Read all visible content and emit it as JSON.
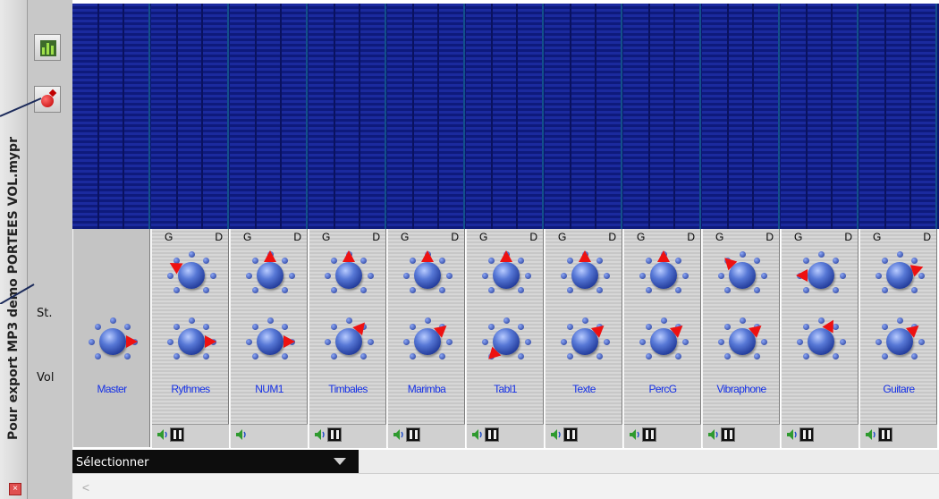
{
  "window": {
    "title": "Pour export MP3 demo PORTEES VOL.mypr",
    "close_glyph": "×"
  },
  "toolbar": {
    "mixer_icon": "mixer-meter-icon",
    "record_icon": "record-icon"
  },
  "row_labels": {
    "stereo": "St.",
    "volume": "Vol"
  },
  "pan_labels": {
    "left": "G",
    "right": "D"
  },
  "channels": [
    {
      "name": "Master",
      "master": true,
      "pan_angle": null,
      "vol_angle": 90,
      "bottom_icons": []
    },
    {
      "name": "Rythmes",
      "master": false,
      "pan_angle": -60,
      "vol_angle": 90,
      "bottom_icons": [
        "speaker",
        "keyboard"
      ]
    },
    {
      "name": "NUM1",
      "master": false,
      "pan_angle": 0,
      "vol_angle": 90,
      "bottom_icons": [
        "speaker"
      ]
    },
    {
      "name": "Timbales",
      "master": false,
      "pan_angle": 0,
      "vol_angle": 40,
      "bottom_icons": [
        "speaker",
        "keyboard"
      ]
    },
    {
      "name": "Marimba",
      "master": false,
      "pan_angle": 0,
      "vol_angle": 50,
      "bottom_icons": [
        "speaker",
        "keyboard"
      ]
    },
    {
      "name": "Tabl1",
      "master": false,
      "pan_angle": 0,
      "vol_angle": -135,
      "bottom_icons": [
        "speaker",
        "keyboard"
      ]
    },
    {
      "name": "Texte",
      "master": false,
      "pan_angle": 0,
      "vol_angle": 50,
      "bottom_icons": [
        "speaker",
        "keyboard"
      ]
    },
    {
      "name": "PercG",
      "master": false,
      "pan_angle": 0,
      "vol_angle": 50,
      "bottom_icons": [
        "speaker",
        "keyboard"
      ]
    },
    {
      "name": "Vibraphone",
      "master": false,
      "pan_angle": -45,
      "vol_angle": 50,
      "bottom_icons": [
        "speaker",
        "keyboard"
      ]
    },
    {
      "name": "",
      "master": false,
      "pan_angle": -90,
      "vol_angle": 30,
      "bottom_icons": [
        "speaker",
        "keyboard"
      ]
    },
    {
      "name": "Guitare",
      "master": false,
      "pan_angle": 70,
      "vol_angle": 50,
      "bottom_icons": [
        "speaker",
        "keyboard"
      ]
    }
  ],
  "selector": {
    "label": "Sélectionner"
  },
  "scroll": {
    "left_glyph": "<"
  },
  "colors": {
    "vu_background": "#0c1672",
    "knob_arrow": "#ee1111",
    "channel_name": "#1530e6"
  }
}
